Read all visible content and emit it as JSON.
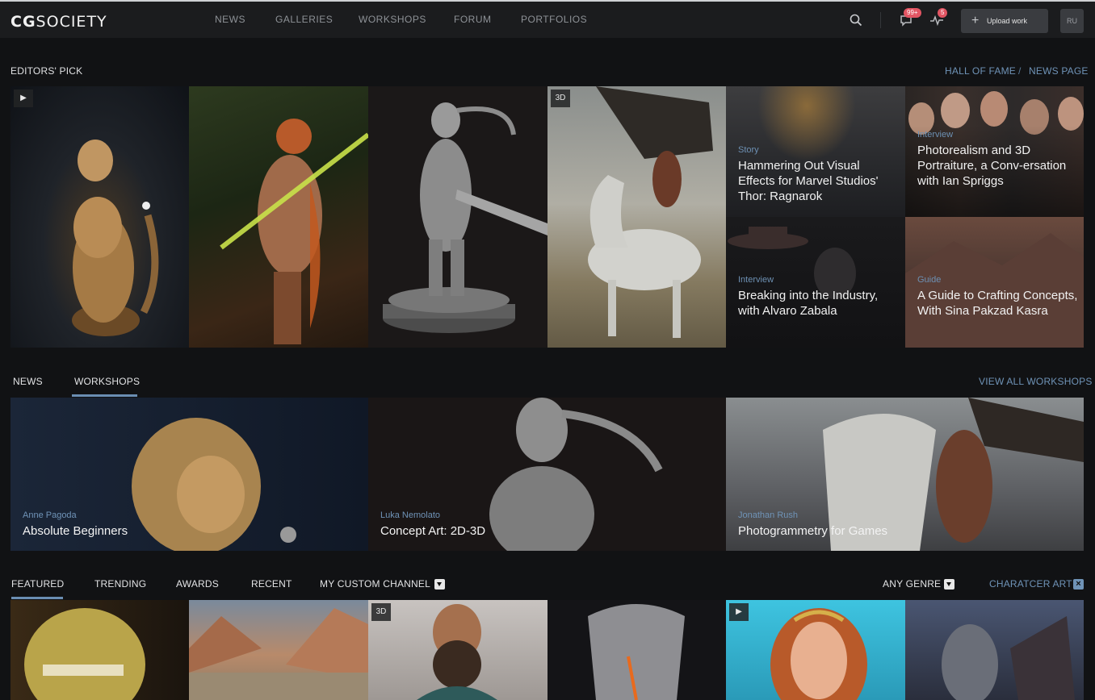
{
  "brand": {
    "logo_bold": "CG",
    "logo_rest": "SOCIETY"
  },
  "nav": [
    "NEWS",
    "GALLERIES",
    "WORKSHOPS",
    "FORUM",
    "PORTFOLIOS"
  ],
  "header": {
    "messages_badge": "99+",
    "activity_badge": "5",
    "upload_label": "Upload work",
    "user_initials": "RU"
  },
  "editors_pick": {
    "label": "EDITORS' PICK",
    "hall_of_fame": "HALL OF FAME",
    "separator": "/",
    "news_page": "NEWS PAGE",
    "chips": {
      "play": "▶",
      "three_d": "3D"
    },
    "articles": [
      {
        "category": "Story",
        "title": "Hammering Out Visual Effects for Marvel Studios' Thor: Ragnarok"
      },
      {
        "category": "Interview",
        "title": "Photorealism and 3D Portraiture, a Conv-ersation with Ian Spriggs"
      },
      {
        "category": "Interview",
        "title": "Breaking into the Industry, with Alvaro Zabala"
      },
      {
        "category": "Guide",
        "title": "A Guide to Crafting Concepts, With Sina Pakzad Kasra"
      }
    ]
  },
  "workshops_section": {
    "tabs": [
      "NEWS",
      "WORKSHOPS"
    ],
    "active_tab": "WORKSHOPS",
    "view_all": "VIEW ALL WORKSHOPS",
    "items": [
      {
        "author": "Anne Pagoda",
        "title": "Absolute Beginners"
      },
      {
        "author": "Luka Nemolato",
        "title": "Concept Art: 2D-3D"
      },
      {
        "author": "Jonathan Rush",
        "title": "Photogrammetry for Games"
      }
    ]
  },
  "feed": {
    "tabs": [
      "FEATURED",
      "TRENDING",
      "AWARDS",
      "RECENT",
      "MY CUSTOM CHANNEL"
    ],
    "active_tab": "FEATURED",
    "genre": "ANY GENRE",
    "filter": "CHARATCER ART",
    "chips": {
      "three_d": "3D",
      "play": "▶"
    }
  },
  "colors": {
    "accent": "#6f93b7",
    "badge": "#e25563",
    "bg": "#111214"
  }
}
